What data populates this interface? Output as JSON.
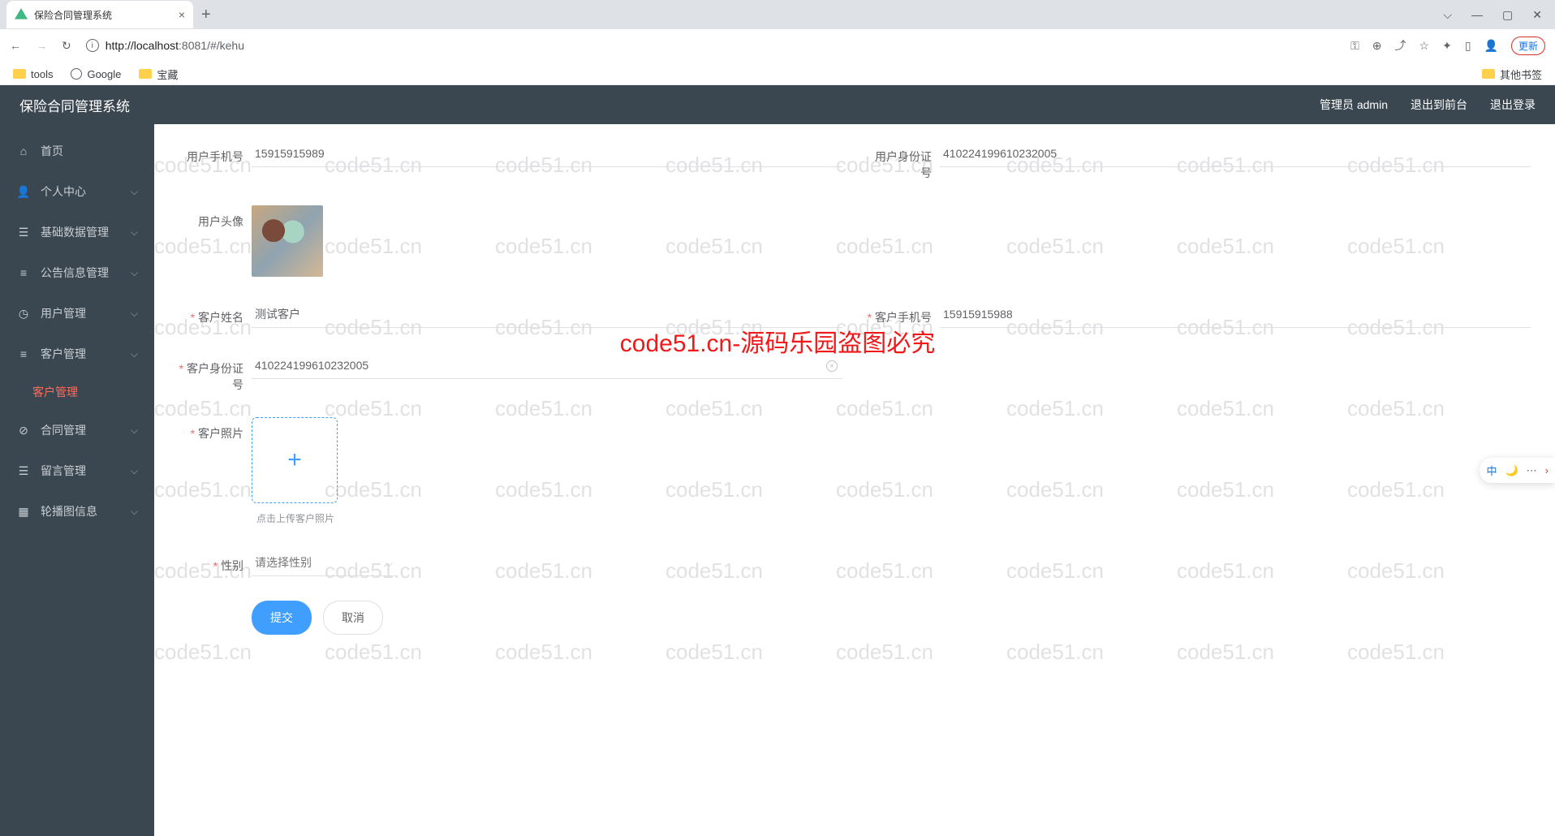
{
  "browser": {
    "tab_title": "保险合同管理系统",
    "url_host": "localhost",
    "url_port": ":8081",
    "url_path": "/#/kehu",
    "update_btn": "更新",
    "bookmarks": [
      {
        "label": "tools",
        "type": "folder"
      },
      {
        "label": "Google",
        "type": "globe"
      },
      {
        "label": "宝藏",
        "type": "folder"
      }
    ],
    "other_bookmarks": "其他书签"
  },
  "header": {
    "title": "保险合同管理系统",
    "user_label": "管理员 admin",
    "back_front": "退出到前台",
    "logout": "退出登录"
  },
  "sidebar": {
    "items": [
      {
        "icon": "home",
        "label": "首页",
        "expand": false
      },
      {
        "icon": "person",
        "label": "个人中心",
        "expand": true
      },
      {
        "icon": "database",
        "label": "基础数据管理",
        "expand": true
      },
      {
        "icon": "announce",
        "label": "公告信息管理",
        "expand": true
      },
      {
        "icon": "clock",
        "label": "用户管理",
        "expand": true
      },
      {
        "icon": "list",
        "label": "客户管理",
        "expand": true,
        "open": true,
        "children": [
          {
            "label": "客户管理",
            "active": true
          }
        ]
      },
      {
        "icon": "check",
        "label": "合同管理",
        "expand": true
      },
      {
        "icon": "msg",
        "label": "留言管理",
        "expand": true
      },
      {
        "icon": "carousel",
        "label": "轮播图信息",
        "expand": true
      }
    ]
  },
  "form": {
    "phone": {
      "label": "用户手机号",
      "value": "15915915989"
    },
    "user_id": {
      "label": "用户身份证号",
      "value": "410224199610232005"
    },
    "avatar": {
      "label": "用户头像"
    },
    "cust_name": {
      "label": "客户姓名",
      "value": "测试客户",
      "required": true
    },
    "cust_phone": {
      "label": "客户手机号",
      "value": "15915915988",
      "required": true
    },
    "cust_id": {
      "label": "客户身份证号",
      "value": "410224199610232005",
      "required": true
    },
    "cust_photo": {
      "label": "客户照片",
      "hint": "点击上传客户照片",
      "required": true
    },
    "gender": {
      "label": "性别",
      "placeholder": "请选择性别",
      "required": true
    },
    "submit": "提交",
    "cancel": "取消"
  },
  "watermark": {
    "text": "code51.cn",
    "center": "code51.cn-源码乐园盗图必究"
  },
  "ime": {
    "lang": "中"
  }
}
